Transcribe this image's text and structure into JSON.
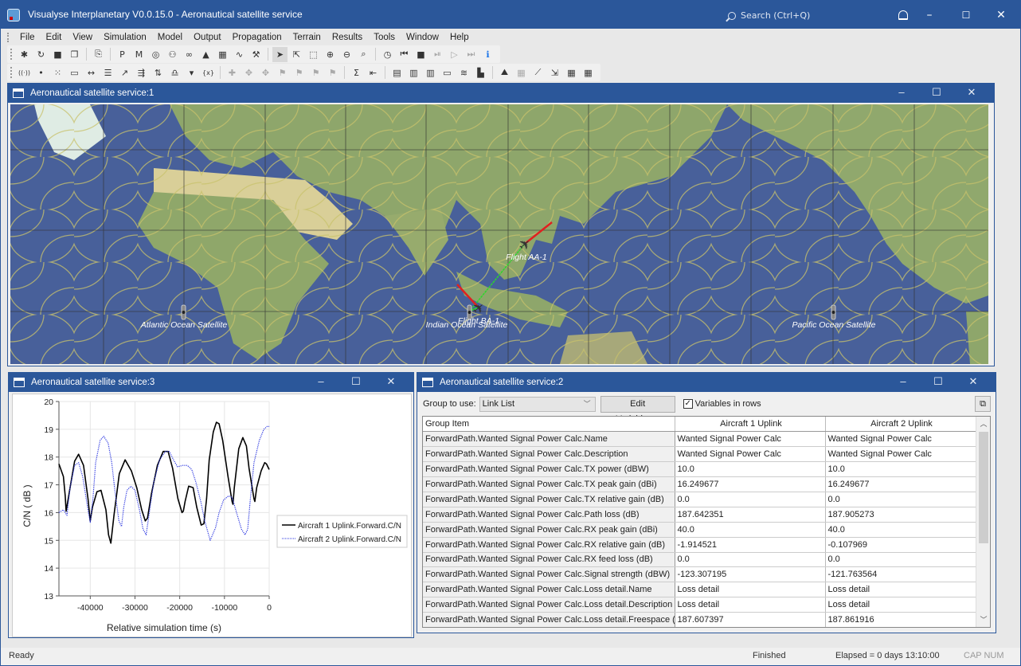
{
  "app": {
    "title": "Visualyse Interplanetary V0.0.15.0 - Aeronautical satellite service",
    "search_placeholder": "Search (Ctrl+Q)",
    "window_controls": {
      "minimize": "–",
      "maximize": "☐",
      "close": "✕"
    }
  },
  "menu": [
    "File",
    "Edit",
    "View",
    "Simulation",
    "Model",
    "Output",
    "Propagation",
    "Terrain",
    "Results",
    "Tools",
    "Window",
    "Help"
  ],
  "toolbar1": [
    {
      "name": "new-icon",
      "glyph": "✱"
    },
    {
      "name": "open-icon",
      "glyph": "↻"
    },
    {
      "name": "save-icon",
      "glyph": "■"
    },
    {
      "name": "close-file-icon",
      "glyph": "❐"
    },
    {
      "sep": true
    },
    {
      "name": "copy-icon",
      "glyph": "⎘"
    },
    {
      "sep": true
    },
    {
      "name": "plan-view-icon",
      "glyph": "P"
    },
    {
      "name": "map-view-icon",
      "glyph": "M"
    },
    {
      "name": "globe-view-icon",
      "glyph": "◎"
    },
    {
      "name": "network-view-icon",
      "glyph": "⚇"
    },
    {
      "name": "glasses-view-icon",
      "glyph": "∞"
    },
    {
      "name": "terrain-view-icon",
      "glyph": "▲"
    },
    {
      "name": "table-view-icon",
      "glyph": "▦"
    },
    {
      "name": "graph-view-icon",
      "glyph": "∿"
    },
    {
      "name": "tools-view-icon",
      "glyph": "⚒"
    },
    {
      "sep": true
    },
    {
      "name": "select-pointer-icon",
      "glyph": "➤",
      "selected": true
    },
    {
      "name": "select-item-icon",
      "glyph": "⇱"
    },
    {
      "name": "select-area-icon",
      "glyph": "⬚"
    },
    {
      "name": "zoom-in-icon",
      "glyph": "⊕"
    },
    {
      "name": "zoom-out-icon",
      "glyph": "⊖"
    },
    {
      "name": "zoom-100-icon",
      "glyph": "⌕"
    },
    {
      "sep": true
    },
    {
      "name": "clock-icon",
      "glyph": "◷"
    },
    {
      "name": "rewind-icon",
      "glyph": "⏮"
    },
    {
      "name": "stop-icon",
      "glyph": "■"
    },
    {
      "name": "step-icon",
      "glyph": "⏯",
      "disabled": true
    },
    {
      "name": "play-icon",
      "glyph": "▷",
      "disabled": true
    },
    {
      "name": "fast-forward-icon",
      "glyph": "⏭",
      "disabled": true
    },
    {
      "name": "info-icon",
      "glyph": "ℹ",
      "blue": true
    }
  ],
  "toolbar2": [
    {
      "name": "antenna-icon",
      "glyph": "((·))"
    },
    {
      "name": "point-icon",
      "glyph": "•"
    },
    {
      "name": "point-grid-icon",
      "glyph": "⁙"
    },
    {
      "name": "rectangle-icon",
      "glyph": "▭"
    },
    {
      "name": "line-icon",
      "glyph": "↔"
    },
    {
      "name": "list-icon",
      "glyph": "☰"
    },
    {
      "name": "link-icon",
      "glyph": "↗"
    },
    {
      "name": "filter-icon",
      "glyph": "⇶"
    },
    {
      "name": "swap-icon",
      "glyph": "⇅"
    },
    {
      "name": "stations-icon",
      "glyph": "♎"
    },
    {
      "name": "dropdown-icon",
      "glyph": "▾"
    },
    {
      "name": "variables-icon",
      "glyph": "{x}"
    },
    {
      "sep": true
    },
    {
      "name": "station-add-icon",
      "glyph": "✚",
      "disabled": true
    },
    {
      "name": "station-move-icon",
      "glyph": "✥",
      "disabled": true
    },
    {
      "name": "station-copy-icon",
      "glyph": "✥",
      "disabled": true
    },
    {
      "name": "group-icon",
      "glyph": "⚑",
      "disabled": true
    },
    {
      "name": "group-user-icon",
      "glyph": "⚑",
      "disabled": true
    },
    {
      "name": "group-link-icon",
      "glyph": "⚑",
      "disabled": true
    },
    {
      "name": "group-tree-icon",
      "glyph": "⚑",
      "disabled": true
    },
    {
      "sep": true
    },
    {
      "name": "sum-icon",
      "glyph": "Σ"
    },
    {
      "name": "import-icon",
      "glyph": "⇤"
    },
    {
      "sep": true
    },
    {
      "name": "report-icon",
      "glyph": "▤"
    },
    {
      "name": "chart-filter-icon",
      "glyph": "▥"
    },
    {
      "name": "chart-add-icon",
      "glyph": "▥"
    },
    {
      "name": "time-chart-icon",
      "glyph": "▭"
    },
    {
      "name": "trend-chart-icon",
      "glyph": "≋"
    },
    {
      "name": "histogram-icon",
      "glyph": "▙"
    },
    {
      "sep": true
    },
    {
      "name": "terrain-icon",
      "glyph": "⛰"
    },
    {
      "name": "terrain-grid-icon",
      "glyph": "▦",
      "disabled": true
    },
    {
      "name": "path-icon",
      "glyph": "⟋"
    },
    {
      "name": "pointer-path-icon",
      "glyph": "⇲"
    },
    {
      "name": "building-add-icon",
      "glyph": "▦"
    },
    {
      "name": "building-filter-icon",
      "glyph": "▦"
    }
  ],
  "map_window": {
    "title": "Aeronautical satellite service:1",
    "satellites": [
      {
        "label": "Atlantic Ocean Satellite"
      },
      {
        "label": "Indian Ocean Satellite"
      },
      {
        "label": "Pacific Ocean Satellite"
      }
    ],
    "aircraft": [
      {
        "label": "Flight AA-1"
      },
      {
        "label": "Flight BA-1"
      }
    ]
  },
  "chart_window": {
    "title": "Aeronautical satellite service:3"
  },
  "chart_data": {
    "type": "line",
    "title": "",
    "xlabel": "Relative simulation time (s)",
    "ylabel": "C/N ( dB )",
    "xlim": [
      -47000,
      0
    ],
    "ylim": [
      13,
      20
    ],
    "xticks": [
      -40000,
      -30000,
      -20000,
      -10000,
      0
    ],
    "yticks": [
      13,
      14,
      15,
      16,
      17,
      18,
      19,
      20
    ],
    "grid": true,
    "legend": "right",
    "series": [
      {
        "name": "Aircraft 1 Uplink.Forward.C/N",
        "color": "#000000",
        "style": "solid",
        "x": [
          -47000,
          -46000,
          -45600,
          -45400,
          -44500,
          -43500,
          -42600,
          -41500,
          -40500,
          -40000,
          -39500,
          -38500,
          -37600,
          -36500,
          -35900,
          -35400,
          -34700,
          -33500,
          -32200,
          -30800,
          -29600,
          -28500,
          -27700,
          -27200,
          -26300,
          -25000,
          -23700,
          -22600,
          -21600,
          -20400,
          -19500,
          -19200,
          -18800,
          -18000,
          -17000,
          -16200,
          -15200,
          -14600,
          -14000,
          -13400,
          -12500,
          -11800,
          -11200,
          -10400,
          -9200,
          -8300,
          -8100,
          -7800,
          -6800,
          -5900,
          -5100,
          -4500,
          -3400,
          -3200,
          -2800,
          -1800,
          -1000,
          -600,
          0
        ],
        "y": [
          17.75,
          17.3,
          16.6,
          16.05,
          16.9,
          17.85,
          18.1,
          17.7,
          16.5,
          15.7,
          16.2,
          16.75,
          16.8,
          16.1,
          15.2,
          14.9,
          15.9,
          17.4,
          17.9,
          17.5,
          16.9,
          16.1,
          15.7,
          15.8,
          16.7,
          17.7,
          18.2,
          18.2,
          17.6,
          16.5,
          16.0,
          16.05,
          16.4,
          16.95,
          16.9,
          16.2,
          15.55,
          15.6,
          16.5,
          17.9,
          18.9,
          19.25,
          19.2,
          18.6,
          17.3,
          16.4,
          16.3,
          16.9,
          18.3,
          18.7,
          18.4,
          17.6,
          16.5,
          16.4,
          16.9,
          17.5,
          17.8,
          17.75,
          17.55
        ]
      },
      {
        "name": "Aircraft 2 Uplink.Forward.C/N",
        "color": "#2a35e0",
        "style": "dotted",
        "x": [
          -47000,
          -46000,
          -45200,
          -44500,
          -43500,
          -42600,
          -41700,
          -40600,
          -40000,
          -39400,
          -38800,
          -37800,
          -37000,
          -36000,
          -35200,
          -34500,
          -33600,
          -33000,
          -32500,
          -31800,
          -30900,
          -30000,
          -29000,
          -28200,
          -27500,
          -26800,
          -25800,
          -24500,
          -23200,
          -22300,
          -21400,
          -20500,
          -19300,
          -18300,
          -17300,
          -16400,
          -15300,
          -14400,
          -13200,
          -12000,
          -11200,
          -10200,
          -9100,
          -8300,
          -7300,
          -6200,
          -5400,
          -4800,
          -4200,
          -3400,
          -2200,
          -1200,
          -500,
          0
        ],
        "y": [
          16.0,
          16.1,
          15.9,
          16.9,
          17.7,
          17.8,
          17.3,
          16.2,
          15.65,
          16.5,
          17.8,
          18.6,
          18.75,
          18.5,
          17.8,
          16.8,
          15.7,
          15.5,
          16.2,
          16.8,
          16.95,
          16.8,
          16.1,
          15.4,
          15.2,
          16.0,
          17.1,
          17.9,
          18.2,
          18.2,
          17.9,
          17.65,
          17.7,
          17.7,
          17.55,
          17.1,
          16.4,
          15.7,
          15.0,
          15.45,
          16.0,
          16.45,
          16.6,
          16.55,
          16.0,
          15.4,
          15.2,
          15.4,
          16.5,
          17.8,
          18.6,
          19.0,
          19.1,
          19.1
        ]
      }
    ]
  },
  "table_window": {
    "title": "Aeronautical satellite service:2",
    "group_label": "Group to use:",
    "group_value": "Link List",
    "edit_button": "Edit Variables...",
    "variables_in_rows_label": "Variables in rows",
    "variables_in_rows_checked": true,
    "columns": [
      "Group Item",
      "Aircraft 1 Uplink",
      "Aircraft 2 Uplink"
    ],
    "rows": [
      [
        "ForwardPath.Wanted Signal Power Calc.Name",
        "Wanted Signal Power Calc",
        "Wanted Signal Power Calc"
      ],
      [
        "ForwardPath.Wanted Signal Power Calc.Description",
        "Wanted Signal Power Calc",
        "Wanted Signal Power Calc"
      ],
      [
        "ForwardPath.Wanted Signal Power Calc.TX power (dBW)",
        "10.0",
        "10.0"
      ],
      [
        "ForwardPath.Wanted Signal Power Calc.TX peak gain (dBi)",
        "16.249677",
        "16.249677"
      ],
      [
        "ForwardPath.Wanted Signal Power Calc.TX relative gain (dB)",
        "0.0",
        "0.0"
      ],
      [
        "ForwardPath.Wanted Signal Power Calc.Path loss (dB)",
        "187.642351",
        "187.905273"
      ],
      [
        "ForwardPath.Wanted Signal Power Calc.RX peak gain (dBi)",
        "40.0",
        "40.0"
      ],
      [
        "ForwardPath.Wanted Signal Power Calc.RX relative gain (dB)",
        "-1.914521",
        "-0.107969"
      ],
      [
        "ForwardPath.Wanted Signal Power Calc.RX feed loss (dB)",
        "0.0",
        "0.0"
      ],
      [
        "ForwardPath.Wanted Signal Power Calc.Signal strength (dBW)",
        "-123.307195",
        "-121.763564"
      ],
      [
        "ForwardPath.Wanted Signal Power Calc.Loss detail.Name",
        "Loss detail",
        "Loss detail"
      ],
      [
        "ForwardPath.Wanted Signal Power Calc.Loss detail.Description",
        "Loss detail",
        "Loss detail"
      ],
      [
        "ForwardPath.Wanted Signal Power Calc.Loss detail.Freespace (dB)",
        "187.607397",
        "187.861916"
      ]
    ]
  },
  "status": {
    "left": "Ready",
    "state": "Finished",
    "elapsed": "Elapsed = 0 days 13:10:00",
    "keys": "CAP NUM"
  }
}
